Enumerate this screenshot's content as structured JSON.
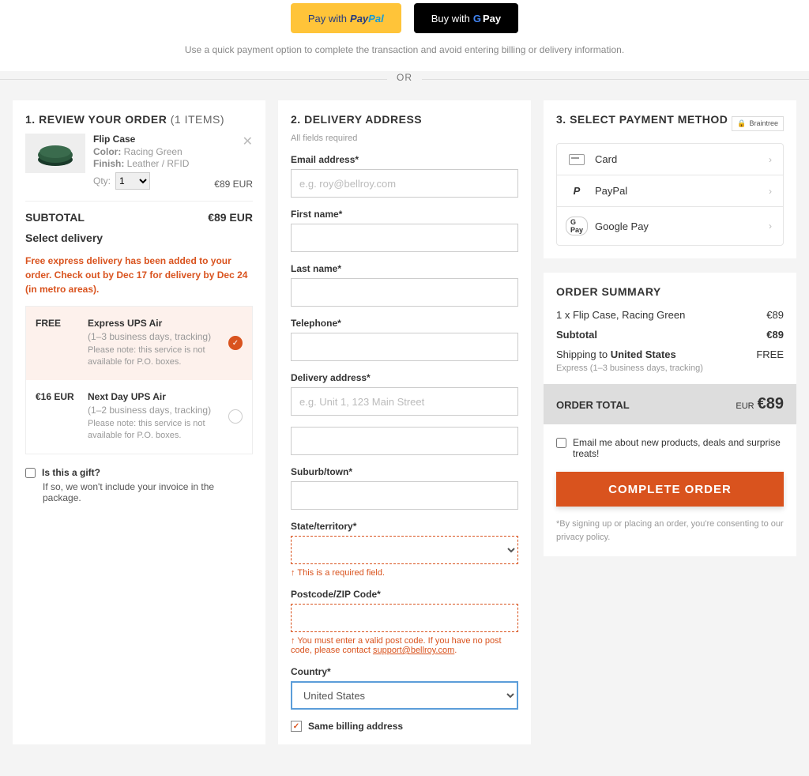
{
  "top": {
    "paypal_prefix": "Pay with",
    "gpay_prefix": "Buy with",
    "quick_note": "Use a quick payment option to complete the transaction and avoid entering billing or delivery information.",
    "or": "OR"
  },
  "review": {
    "step": "1.",
    "title": "REVIEW YOUR ORDER",
    "count": "(1 ITEMS)",
    "item": {
      "name": "Flip Case",
      "color_label": "Color:",
      "color": "Racing Green",
      "finish_label": "Finish:",
      "finish": "Leather / RFID",
      "qty_label": "Qty:",
      "qty": "1",
      "price": "€89 EUR"
    },
    "subtotal_label": "SUBTOTAL",
    "subtotal_value": "€89 EUR",
    "select_delivery": "Select delivery",
    "promo": "Free express delivery has been added to your order. Check out by Dec 17 for delivery by Dec 24 (in metro areas).",
    "ship": [
      {
        "price": "FREE",
        "name": "Express UPS Air",
        "detail": "(1–3 business days, tracking)",
        "note": "Please note: this service is not available for P.O. boxes.",
        "selected": true
      },
      {
        "price": "€16 EUR",
        "name": "Next Day UPS Air",
        "detail": "(1–2 business days, tracking)",
        "note": "Please note: this service is not available for P.O. boxes.",
        "selected": false
      }
    ],
    "gift_q": "Is this a gift?",
    "gift_sub": "If so, we won't include your invoice in the package."
  },
  "delivery": {
    "step": "2.",
    "title": "DELIVERY ADDRESS",
    "req": "All fields required",
    "email_label": "Email address*",
    "email_ph": "e.g. roy@bellroy.com",
    "first_label": "First name*",
    "last_label": "Last name*",
    "tel_label": "Telephone*",
    "addr_label": "Delivery address*",
    "addr_ph": "e.g. Unit 1, 123 Main Street",
    "suburb_label": "Suburb/town*",
    "state_label": "State/territory*",
    "state_err": "This is a required field.",
    "zip_label": "Postcode/ZIP Code*",
    "zip_err": "You must enter a valid post code. If you have no post code, please contact ",
    "zip_err_link": "support@bellroy.com",
    "country_label": "Country*",
    "country_value": "United States",
    "same_billing": "Same billing address"
  },
  "payment": {
    "step": "3.",
    "title": "SELECT PAYMENT METHOD",
    "braintree": "Braintree",
    "methods": {
      "card": "Card",
      "paypal": "PayPal",
      "gpay": "Google Pay"
    }
  },
  "summary": {
    "title": "ORDER SUMMARY",
    "line1_label": "1 x Flip Case, Racing Green",
    "line1_val": "€89",
    "sub_label": "Subtotal",
    "sub_val": "€89",
    "ship_label": "Shipping to",
    "ship_country": "United States",
    "ship_val": "FREE",
    "ship_note": "Express (1–3 business days, tracking)",
    "total_label": "ORDER TOTAL",
    "total_cur": "EUR",
    "total_val": "€89",
    "email_opt": "Email me about new products, deals and surprise treats!",
    "complete": "COMPLETE ORDER",
    "disclaimer": "*By signing up or placing an order, you're consenting to our privacy policy."
  }
}
